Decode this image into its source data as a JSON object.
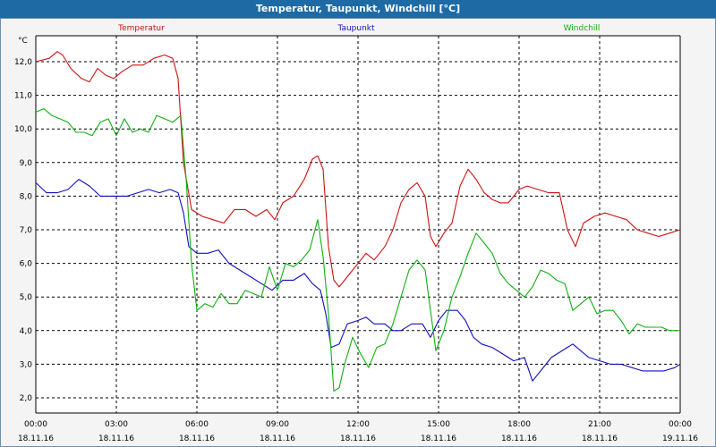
{
  "window": {
    "title": "Temperatur, Taupunkt, Windchill [°C]"
  },
  "chart_data": {
    "type": "line",
    "title": "Temperatur, Taupunkt, Windchill [°C]",
    "yunit": "°C",
    "ylim": [
      1.5,
      12.8
    ],
    "yticks": [
      "2,0",
      "3,0",
      "4,0",
      "5,0",
      "6,0",
      "7,0",
      "8,0",
      "9,0",
      "10,0",
      "11,0",
      "12,0"
    ],
    "yticks_values": [
      2,
      3,
      4,
      5,
      6,
      7,
      8,
      9,
      10,
      11,
      12
    ],
    "xlim": [
      0,
      24
    ],
    "xticks": [
      {
        "time": "00:00",
        "date": "18.11.16",
        "h": 0
      },
      {
        "time": "03:00",
        "date": "18.11.16",
        "h": 3
      },
      {
        "time": "06:00",
        "date": "18.11.16",
        "h": 6
      },
      {
        "time": "09:00",
        "date": "18.11.16",
        "h": 9
      },
      {
        "time": "12:00",
        "date": "18.11.16",
        "h": 12
      },
      {
        "time": "15:00",
        "date": "18.11.16",
        "h": 15
      },
      {
        "time": "18:00",
        "date": "18.11.16",
        "h": 18
      },
      {
        "time": "21:00",
        "date": "18.11.16",
        "h": 21
      },
      {
        "time": "00:00",
        "date": "19.11.16",
        "h": 24
      }
    ],
    "grid": true,
    "series": [
      {
        "name": "Temperatur",
        "color": "#d01010",
        "points": [
          [
            0,
            12.0
          ],
          [
            0.5,
            12.1
          ],
          [
            0.8,
            12.3
          ],
          [
            1.0,
            12.2
          ],
          [
            1.3,
            11.8
          ],
          [
            1.7,
            11.5
          ],
          [
            2.0,
            11.4
          ],
          [
            2.3,
            11.8
          ],
          [
            2.6,
            11.6
          ],
          [
            2.9,
            11.5
          ],
          [
            3.2,
            11.7
          ],
          [
            3.6,
            11.9
          ],
          [
            4.0,
            11.9
          ],
          [
            4.4,
            12.1
          ],
          [
            4.8,
            12.2
          ],
          [
            5.1,
            12.1
          ],
          [
            5.3,
            11.5
          ],
          [
            5.5,
            9.0
          ],
          [
            5.8,
            7.6
          ],
          [
            6.2,
            7.4
          ],
          [
            6.6,
            7.3
          ],
          [
            7.0,
            7.2
          ],
          [
            7.4,
            7.6
          ],
          [
            7.8,
            7.6
          ],
          [
            8.2,
            7.4
          ],
          [
            8.6,
            7.6
          ],
          [
            8.9,
            7.3
          ],
          [
            9.2,
            7.8
          ],
          [
            9.6,
            8.0
          ],
          [
            10.0,
            8.5
          ],
          [
            10.3,
            9.1
          ],
          [
            10.5,
            9.2
          ],
          [
            10.7,
            8.8
          ],
          [
            10.9,
            6.5
          ],
          [
            11.1,
            5.5
          ],
          [
            11.3,
            5.3
          ],
          [
            11.6,
            5.6
          ],
          [
            12.0,
            6.0
          ],
          [
            12.3,
            6.3
          ],
          [
            12.6,
            6.1
          ],
          [
            13.0,
            6.5
          ],
          [
            13.3,
            7.0
          ],
          [
            13.6,
            7.8
          ],
          [
            13.9,
            8.2
          ],
          [
            14.2,
            8.4
          ],
          [
            14.5,
            8.0
          ],
          [
            14.7,
            6.8
          ],
          [
            14.9,
            6.5
          ],
          [
            15.2,
            6.9
          ],
          [
            15.5,
            7.2
          ],
          [
            15.8,
            8.3
          ],
          [
            16.1,
            8.8
          ],
          [
            16.4,
            8.5
          ],
          [
            16.7,
            8.1
          ],
          [
            17.0,
            7.9
          ],
          [
            17.3,
            7.8
          ],
          [
            17.6,
            7.8
          ],
          [
            18.0,
            8.2
          ],
          [
            18.3,
            8.3
          ],
          [
            18.7,
            8.2
          ],
          [
            19.1,
            8.1
          ],
          [
            19.5,
            8.1
          ],
          [
            19.8,
            7.0
          ],
          [
            20.1,
            6.5
          ],
          [
            20.4,
            7.2
          ],
          [
            20.8,
            7.4
          ],
          [
            21.2,
            7.5
          ],
          [
            21.6,
            7.4
          ],
          [
            22.0,
            7.3
          ],
          [
            22.4,
            7.0
          ],
          [
            22.8,
            6.9
          ],
          [
            23.2,
            6.8
          ],
          [
            23.6,
            6.9
          ],
          [
            24.0,
            7.0
          ]
        ]
      },
      {
        "name": "Taupunkt",
        "color": "#1010c0",
        "points": [
          [
            0,
            8.4
          ],
          [
            0.4,
            8.1
          ],
          [
            0.8,
            8.1
          ],
          [
            1.2,
            8.2
          ],
          [
            1.6,
            8.5
          ],
          [
            2.0,
            8.3
          ],
          [
            2.4,
            8.0
          ],
          [
            3.0,
            8.0
          ],
          [
            3.4,
            8.0
          ],
          [
            3.8,
            8.1
          ],
          [
            4.2,
            8.2
          ],
          [
            4.6,
            8.1
          ],
          [
            5.0,
            8.2
          ],
          [
            5.3,
            8.1
          ],
          [
            5.5,
            7.5
          ],
          [
            5.7,
            6.5
          ],
          [
            6.0,
            6.3
          ],
          [
            6.4,
            6.3
          ],
          [
            6.8,
            6.4
          ],
          [
            7.2,
            6.0
          ],
          [
            7.6,
            5.8
          ],
          [
            8.0,
            5.6
          ],
          [
            8.4,
            5.4
          ],
          [
            8.8,
            5.2
          ],
          [
            9.2,
            5.5
          ],
          [
            9.6,
            5.5
          ],
          [
            10.0,
            5.7
          ],
          [
            10.3,
            5.4
          ],
          [
            10.6,
            5.2
          ],
          [
            10.8,
            4.5
          ],
          [
            11.0,
            3.5
          ],
          [
            11.3,
            3.6
          ],
          [
            11.6,
            4.2
          ],
          [
            12.0,
            4.3
          ],
          [
            12.3,
            4.4
          ],
          [
            12.6,
            4.2
          ],
          [
            13.0,
            4.2
          ],
          [
            13.3,
            4.0
          ],
          [
            13.6,
            4.0
          ],
          [
            14.0,
            4.2
          ],
          [
            14.4,
            4.2
          ],
          [
            14.7,
            3.8
          ],
          [
            15.0,
            4.3
          ],
          [
            15.3,
            4.6
          ],
          [
            15.7,
            4.6
          ],
          [
            16.0,
            4.3
          ],
          [
            16.3,
            3.8
          ],
          [
            16.6,
            3.6
          ],
          [
            17.0,
            3.5
          ],
          [
            17.4,
            3.3
          ],
          [
            17.8,
            3.1
          ],
          [
            18.2,
            3.2
          ],
          [
            18.5,
            2.5
          ],
          [
            18.8,
            2.8
          ],
          [
            19.2,
            3.2
          ],
          [
            19.6,
            3.4
          ],
          [
            20.0,
            3.6
          ],
          [
            20.3,
            3.4
          ],
          [
            20.6,
            3.2
          ],
          [
            21.0,
            3.1
          ],
          [
            21.4,
            3.0
          ],
          [
            21.8,
            3.0
          ],
          [
            22.2,
            2.9
          ],
          [
            22.6,
            2.8
          ],
          [
            23.0,
            2.8
          ],
          [
            23.4,
            2.8
          ],
          [
            23.8,
            2.9
          ],
          [
            24.0,
            3.0
          ]
        ]
      },
      {
        "name": "Windchill",
        "color": "#10b010",
        "points": [
          [
            0,
            10.5
          ],
          [
            0.3,
            10.6
          ],
          [
            0.6,
            10.4
          ],
          [
            0.9,
            10.3
          ],
          [
            1.2,
            10.2
          ],
          [
            1.5,
            9.9
          ],
          [
            1.8,
            9.9
          ],
          [
            2.1,
            9.8
          ],
          [
            2.4,
            10.2
          ],
          [
            2.7,
            10.3
          ],
          [
            3.0,
            9.8
          ],
          [
            3.3,
            10.3
          ],
          [
            3.6,
            9.9
          ],
          [
            3.9,
            10.0
          ],
          [
            4.2,
            9.9
          ],
          [
            4.5,
            10.4
          ],
          [
            4.8,
            10.3
          ],
          [
            5.1,
            10.2
          ],
          [
            5.4,
            10.4
          ],
          [
            5.6,
            8.5
          ],
          [
            5.8,
            6.0
          ],
          [
            6.0,
            4.6
          ],
          [
            6.3,
            4.8
          ],
          [
            6.6,
            4.7
          ],
          [
            6.9,
            5.1
          ],
          [
            7.2,
            4.8
          ],
          [
            7.5,
            4.8
          ],
          [
            7.8,
            5.2
          ],
          [
            8.1,
            5.1
          ],
          [
            8.4,
            5.0
          ],
          [
            8.7,
            5.9
          ],
          [
            9.0,
            5.2
          ],
          [
            9.3,
            6.0
          ],
          [
            9.6,
            5.9
          ],
          [
            9.9,
            6.1
          ],
          [
            10.2,
            6.4
          ],
          [
            10.5,
            7.3
          ],
          [
            10.7,
            6.2
          ],
          [
            10.9,
            4.5
          ],
          [
            11.1,
            2.2
          ],
          [
            11.3,
            2.3
          ],
          [
            11.5,
            3.0
          ],
          [
            11.8,
            3.8
          ],
          [
            12.1,
            3.3
          ],
          [
            12.4,
            2.9
          ],
          [
            12.7,
            3.5
          ],
          [
            13.0,
            3.6
          ],
          [
            13.3,
            4.2
          ],
          [
            13.6,
            5.0
          ],
          [
            13.9,
            5.8
          ],
          [
            14.2,
            6.1
          ],
          [
            14.5,
            5.8
          ],
          [
            14.7,
            4.6
          ],
          [
            14.9,
            3.4
          ],
          [
            15.2,
            4.0
          ],
          [
            15.5,
            5.0
          ],
          [
            15.8,
            5.6
          ],
          [
            16.1,
            6.3
          ],
          [
            16.4,
            6.9
          ],
          [
            16.7,
            6.6
          ],
          [
            17.0,
            6.3
          ],
          [
            17.3,
            5.7
          ],
          [
            17.6,
            5.4
          ],
          [
            17.9,
            5.2
          ],
          [
            18.2,
            5.0
          ],
          [
            18.5,
            5.3
          ],
          [
            18.8,
            5.8
          ],
          [
            19.1,
            5.7
          ],
          [
            19.4,
            5.5
          ],
          [
            19.7,
            5.4
          ],
          [
            20.0,
            4.6
          ],
          [
            20.3,
            4.8
          ],
          [
            20.6,
            5.0
          ],
          [
            20.9,
            4.5
          ],
          [
            21.2,
            4.6
          ],
          [
            21.5,
            4.6
          ],
          [
            21.8,
            4.3
          ],
          [
            22.1,
            3.9
          ],
          [
            22.4,
            4.2
          ],
          [
            22.7,
            4.1
          ],
          [
            23.0,
            4.1
          ],
          [
            23.3,
            4.1
          ],
          [
            23.6,
            4.0
          ],
          [
            24.0,
            4.0
          ]
        ]
      }
    ]
  }
}
